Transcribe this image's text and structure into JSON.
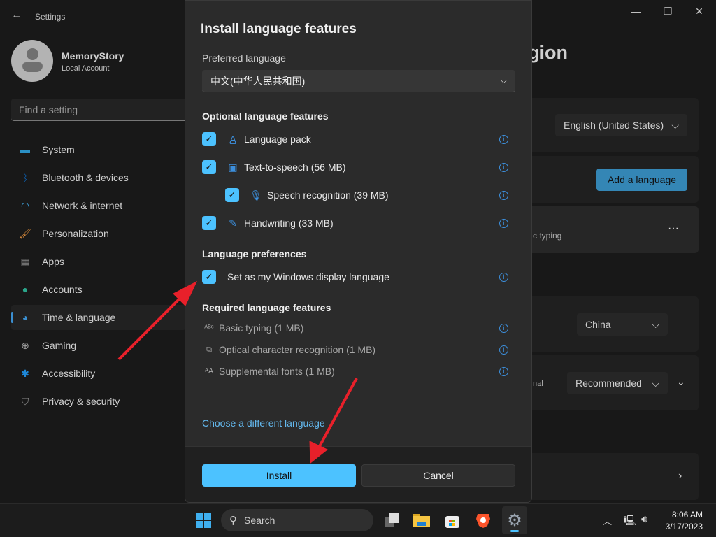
{
  "window": {
    "title": "Settings",
    "controls": [
      "minimize-icon",
      "restore-icon",
      "close-icon"
    ]
  },
  "user": {
    "name": "MemoryStory",
    "account": "Local Account"
  },
  "search": {
    "placeholder": "Find a setting"
  },
  "sidebar": {
    "items": [
      {
        "label": "System",
        "icon": "system-icon",
        "color": "#2a8fc4"
      },
      {
        "label": "Bluetooth & devices",
        "icon": "bluetooth-icon",
        "color": "#0a6fd0"
      },
      {
        "label": "Network & internet",
        "icon": "wifi-icon",
        "color": "#3fa9e8"
      },
      {
        "label": "Personalization",
        "icon": "brush-icon",
        "color": "#d98a3a"
      },
      {
        "label": "Apps",
        "icon": "apps-icon",
        "color": "#7d7d7d"
      },
      {
        "label": "Accounts",
        "icon": "accounts-icon",
        "color": "#2aa58a"
      },
      {
        "label": "Time & language",
        "icon": "globe-clock-icon",
        "color": "#3a8fd0",
        "selected": true
      },
      {
        "label": "Gaming",
        "icon": "gamepad-icon",
        "color": "#9a9a9a"
      },
      {
        "label": "Accessibility",
        "icon": "accessibility-icon",
        "color": "#1e88d8"
      },
      {
        "label": "Privacy & security",
        "icon": "shield-icon",
        "color": "#8a8a8a"
      }
    ]
  },
  "background": {
    "title_fragment": "egion",
    "display_language": "English (United States)",
    "add_language": "Add a language",
    "lang_sub_fragment": "c typing",
    "more": "···",
    "country": "China",
    "format_fragment": "nal",
    "format_value": "Recommended"
  },
  "dialog": {
    "title": "Install language features",
    "preferred_label": "Preferred language",
    "preferred_value": "中文(中华人民共和国)",
    "optional_heading": "Optional language features",
    "optional": [
      {
        "label": "Language pack",
        "checked": true,
        "icon": "language-pack-icon"
      },
      {
        "label": "Text-to-speech (56 MB)",
        "checked": true,
        "icon": "text-to-speech-icon"
      },
      {
        "label": "Speech recognition (39 MB)",
        "checked": true,
        "icon": "microphone-icon",
        "indent": true
      },
      {
        "label": "Handwriting (33 MB)",
        "checked": true,
        "icon": "handwriting-icon"
      }
    ],
    "prefs_heading": "Language preferences",
    "display_language_label": "Set as my Windows display language",
    "display_language_checked": true,
    "required_heading": "Required language features",
    "required": [
      {
        "label": "Basic typing (1 MB)",
        "icon": "abc-check-icon"
      },
      {
        "label": "Optical character recognition (1 MB)",
        "icon": "ocr-icon"
      },
      {
        "label": "Supplemental fonts (1 MB)",
        "icon": "fonts-icon"
      }
    ],
    "choose_link": "Choose a different language",
    "install": "Install",
    "cancel": "Cancel",
    "accent": "#4cc2ff"
  },
  "annotations": {
    "arrow_color": "#e8202a"
  },
  "taskbar": {
    "search": "Search",
    "time": "8:06 AM",
    "date": "3/17/2023"
  }
}
